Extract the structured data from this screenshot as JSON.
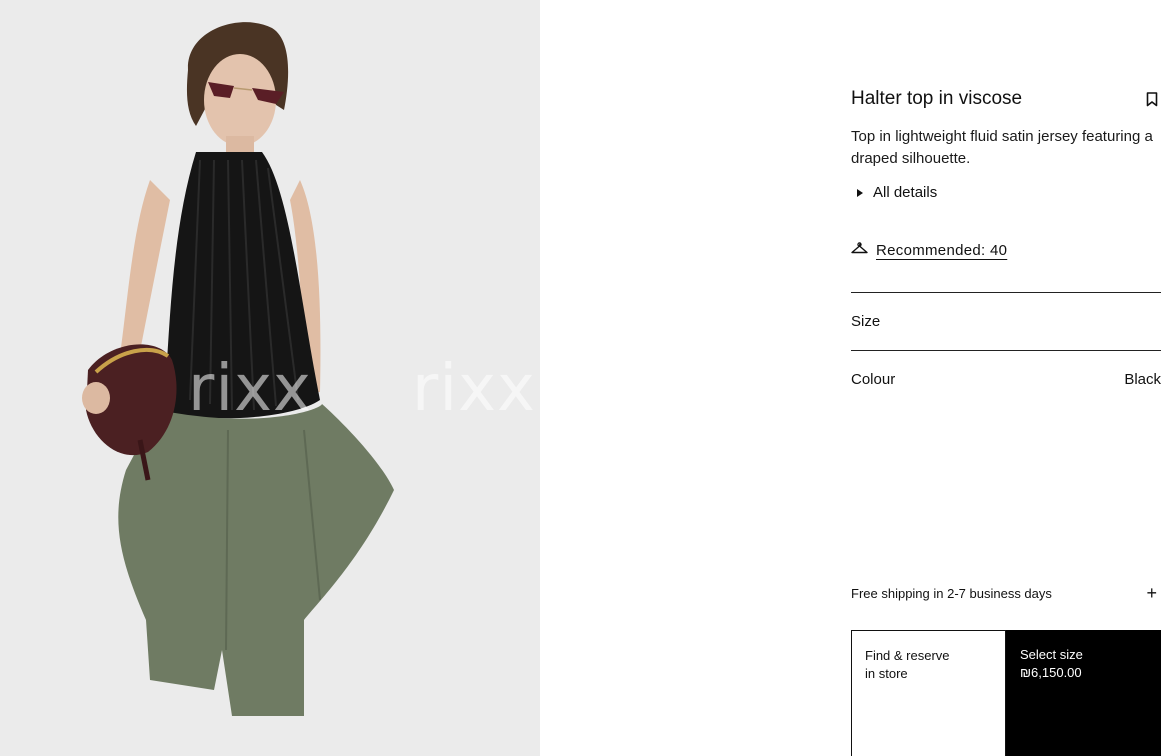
{
  "image": {
    "watermark_text": "rixx"
  },
  "product": {
    "title": "Halter top in viscose",
    "description": "Top in lightweight fluid satin jersey featuring a draped silhouette.",
    "details_label": "All details",
    "recommended_label": "Recommended: 40",
    "size_label": "Size",
    "colour_label": "Colour",
    "colour_value": "Black"
  },
  "shipping": {
    "label": "Free shipping in 2-7 business days",
    "expand_symbol": "+"
  },
  "actions": {
    "find_store_line1": "Find & reserve",
    "find_store_line2": "in store",
    "select_size_label": "Select size",
    "price": "₪6,150.00"
  },
  "colors": {
    "top": "#151515",
    "trousers": "#6f7b63",
    "bag": "#4b2022",
    "button_dark": "#000000"
  }
}
